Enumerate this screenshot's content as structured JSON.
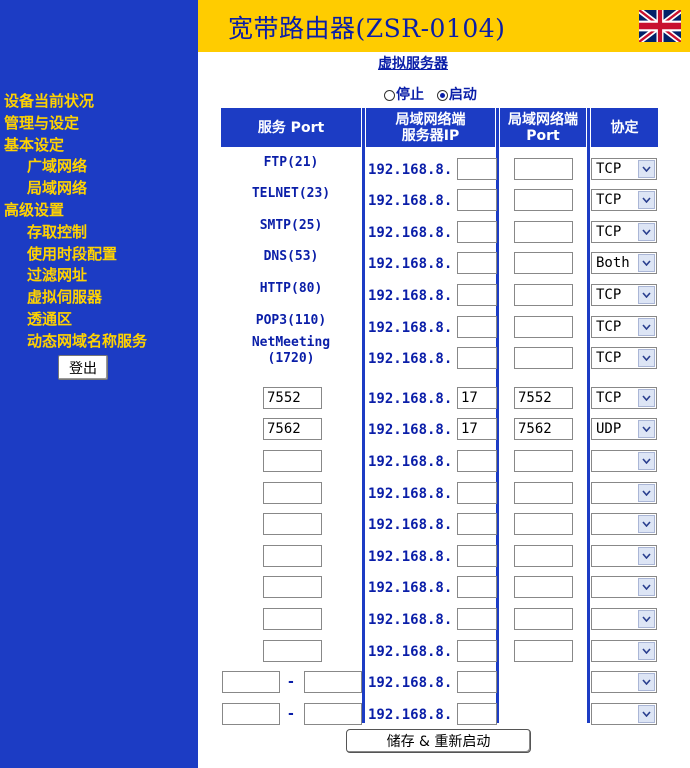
{
  "header": {
    "title": "宽带路由器(ZSR-0104)",
    "flag_icon": "uk-flag-icon"
  },
  "sidebar": {
    "items": [
      {
        "label": "设备当前状况",
        "sub": false
      },
      {
        "label": "管理与设定",
        "sub": false
      },
      {
        "label": "基本设定",
        "sub": false
      },
      {
        "label": "广域网络",
        "sub": true
      },
      {
        "label": "局域网络",
        "sub": true
      },
      {
        "label": "高级设置",
        "sub": false
      },
      {
        "label": "存取控制",
        "sub": true
      },
      {
        "label": "使用时段配置",
        "sub": true
      },
      {
        "label": "过滤网址",
        "sub": true
      },
      {
        "label": "虚拟伺服器",
        "sub": true
      },
      {
        "label": "透通区",
        "sub": true
      },
      {
        "label": "动态网域名称服务",
        "sub": true
      }
    ],
    "logout_label": "登出"
  },
  "main": {
    "heading": "虚拟服务器",
    "status": {
      "stop_label": "停止",
      "start_label": "启动",
      "selected": "start"
    },
    "columns": {
      "service": "服务 Port",
      "lan_ip": "局域网络端\n服务器IP",
      "lan_port": "局域网络端\nPort",
      "protocol": "协定"
    },
    "ip_prefix": "192.168.8.",
    "rows": [
      {
        "service": "FTP(21)",
        "ip_last": "",
        "port": "",
        "protocol": "TCP"
      },
      {
        "service": "TELNET(23)",
        "ip_last": "",
        "port": "",
        "protocol": "TCP"
      },
      {
        "service": "SMTP(25)",
        "ip_last": "",
        "port": "",
        "protocol": "TCP"
      },
      {
        "service": "DNS(53)",
        "ip_last": "",
        "port": "",
        "protocol": "Both"
      },
      {
        "service": "HTTP(80)",
        "ip_last": "",
        "port": "",
        "protocol": "TCP"
      },
      {
        "service": "POP3(110)",
        "ip_last": "",
        "port": "",
        "protocol": "TCP"
      },
      {
        "service": "NetMeeting\n(1720)",
        "ip_last": "",
        "port": "",
        "protocol": "TCP"
      },
      {
        "service_input": "7552",
        "ip_last": "17",
        "port": "7552",
        "protocol": "TCP"
      },
      {
        "service_input": "7562",
        "ip_last": "17",
        "port": "7562",
        "protocol": "UDP"
      },
      {
        "service_input": "",
        "ip_last": "",
        "port": "",
        "protocol": ""
      },
      {
        "service_input": "",
        "ip_last": "",
        "port": "",
        "protocol": ""
      },
      {
        "service_input": "",
        "ip_last": "",
        "port": "",
        "protocol": ""
      },
      {
        "service_input": "",
        "ip_last": "",
        "port": "",
        "protocol": ""
      },
      {
        "service_input": "",
        "ip_last": "",
        "port": "",
        "protocol": ""
      },
      {
        "service_input": "",
        "ip_last": "",
        "port": "",
        "protocol": ""
      },
      {
        "service_input": "",
        "ip_last": "",
        "port": "",
        "protocol": ""
      },
      {
        "range_start": "",
        "range_end": "",
        "range_separator": "-",
        "ip_last": "",
        "protocol": ""
      },
      {
        "range_start": "",
        "range_end": "",
        "range_separator": "-",
        "ip_last": "",
        "protocol": ""
      }
    ],
    "save_label": "储存 & 重新启动"
  },
  "colors": {
    "sidebar_bg": "#1c3cc4",
    "sidebar_text": "#ffd200",
    "header_bg": "#ffcc00",
    "title_color": "#0a1ea8"
  }
}
